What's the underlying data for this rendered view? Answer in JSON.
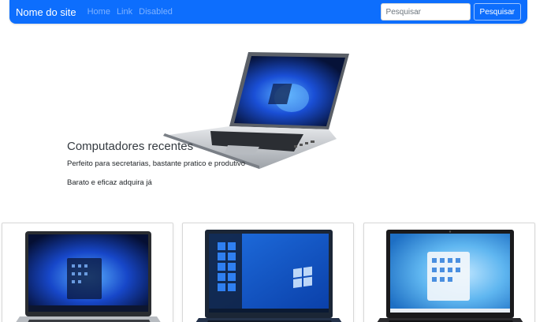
{
  "navbar": {
    "brand": "Nome do site",
    "links": [
      "Home",
      "Link",
      "Disabled"
    ],
    "search": {
      "placeholder": "Pesquisar",
      "button_label": "Pesquisar"
    }
  },
  "hero": {
    "title": "Computadores recentes",
    "paragraphs": [
      "Perfeito para secretarias, bastante pratico e produtivo",
      "Barato e eficaz adquira já"
    ]
  },
  "products": [
    {
      "image": "silver-laptop-windows11"
    },
    {
      "image": "dark-blue-laptop-windows10"
    },
    {
      "image": "black-laptop-windows11"
    }
  ],
  "colors": {
    "navbar_bg": "#0d6efd",
    "brand": "#ffffff",
    "link": "#7fb2ff"
  }
}
